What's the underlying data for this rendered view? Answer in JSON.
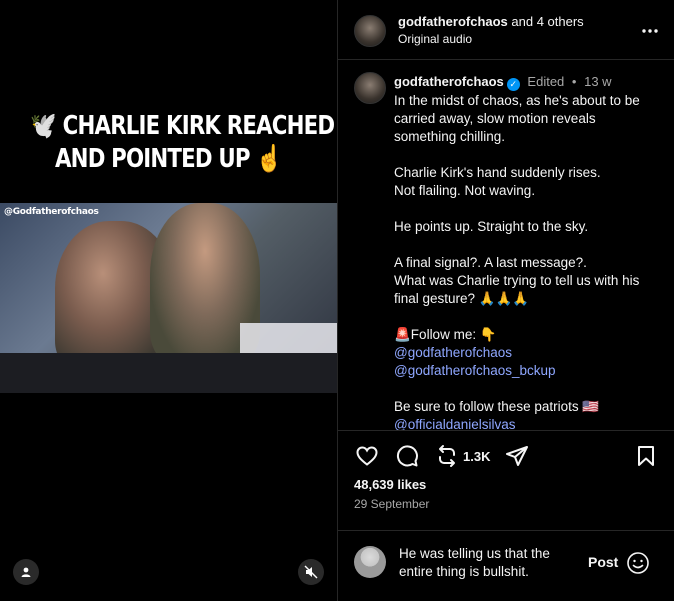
{
  "media": {
    "headline_line1": "🕊️ CHARLIE KIRK REACHED",
    "headline_line2": "AND POINTED UP ☝️",
    "watermark": "@Godfatherofchaos",
    "profile_icon": "person-icon",
    "mute_icon": "muted-speaker-icon"
  },
  "header": {
    "user": "godfatherofchaos",
    "others": " and 4 others",
    "audio": "Original audio",
    "more_icon": "ellipsis-icon"
  },
  "caption": {
    "user": "godfatherofchaos",
    "verified_icon": "verified-badge-icon",
    "edited": "Edited",
    "dot": "•",
    "age": "13 w",
    "p1": "In the midst of chaos, as he's about to be carried away, slow motion reveals something chilling.",
    "p2_line1": "Charlie Kirk's hand suddenly rises.",
    "p2_line2": "Not flailing. Not waving.",
    "p3": "He points up. Straight to the sky.",
    "p4_line1": "A final signal?. A last message?.",
    "p4_line2": "What was Charlie trying to tell us with his final gesture? 🙏🙏🙏",
    "follow": "🚨Follow me: 👇",
    "link1": "@godfatherofchaos",
    "link2": "@godfatherofchaos_bckup",
    "patriots": "Be sure to follow these patriots 🇺🇸",
    "link3": "@officialdanielsilvas"
  },
  "actions": {
    "like_icon": "heart-icon",
    "comment_icon": "comment-bubble-icon",
    "repost_icon": "repost-icon",
    "repost_count": "1.3K",
    "share_icon": "send-icon",
    "save_icon": "bookmark-icon",
    "likes": "48,639 likes",
    "date": "29 September"
  },
  "comment_box": {
    "text": "He was telling us that the entire thing is bullshit.",
    "post_label": "Post",
    "emoji_icon": "smiley-icon"
  },
  "colors": {
    "background": "#000000",
    "link": "#8fa7ff",
    "verified": "#0095f6",
    "muted_text": "#a8a8a8"
  }
}
